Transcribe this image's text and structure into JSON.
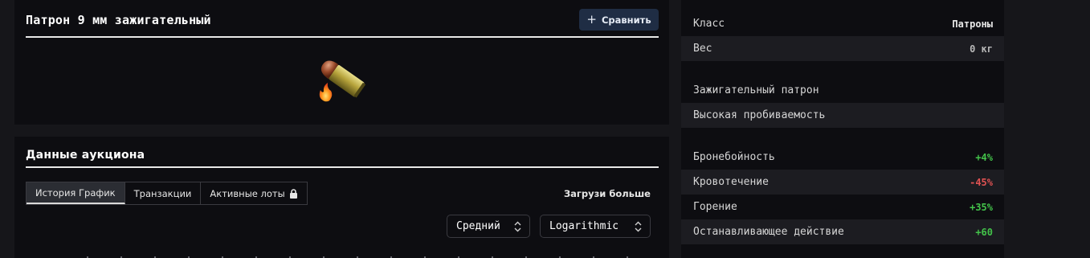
{
  "item": {
    "title": "Патрон 9 мм зажигательный",
    "compare_label": "Сравнить"
  },
  "auction": {
    "title": "Данные аукциона",
    "tabs": [
      {
        "label": "История График",
        "active": true
      },
      {
        "label": "Транзакции",
        "active": false
      },
      {
        "label": "Активные лоты",
        "active": false,
        "icon": "lock-icon"
      }
    ],
    "load_more": "Загрузи больше",
    "mode_select": "Средний",
    "scale_select": "Logarithmic"
  },
  "stats": {
    "class_label": "Класс",
    "class_value": "Патроны",
    "weight_label": "Вес",
    "weight_value": "0 кг",
    "features": [
      "Зажигательный патрон",
      "Высокая пробиваемость"
    ],
    "modifiers": [
      {
        "label": "Бронебойность",
        "value": "+4%",
        "tone": "positive"
      },
      {
        "label": "Кровотечение",
        "value": "-45%",
        "tone": "negative"
      },
      {
        "label": "Горение",
        "value": "+35%",
        "tone": "positive"
      },
      {
        "label": "Останавливающее действие",
        "value": "+60",
        "tone": "positive"
      }
    ]
  },
  "colors": {
    "page_bg": "#16161a",
    "panel_bg": "#0d0d11",
    "accent_button": "#1f2d44",
    "positive": "#43c34a",
    "negative": "#e05252"
  }
}
